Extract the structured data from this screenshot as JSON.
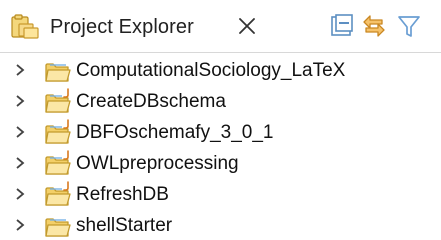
{
  "view": {
    "title": "Project Explorer",
    "toolbar": {
      "collapse_all": "collapse-all-icon",
      "link_with_editor": "link-with-editor-icon",
      "filter": "filter-icon"
    }
  },
  "projects": [
    {
      "name": "ComputationalSociology_LaTeX",
      "java": false
    },
    {
      "name": "CreateDBschema",
      "java": true
    },
    {
      "name": "DBFOschemafy_3_0_1",
      "java": true
    },
    {
      "name": "OWLpreprocessing",
      "java": true
    },
    {
      "name": "RefreshDB",
      "java": true
    },
    {
      "name": "shellStarter",
      "java": false
    }
  ],
  "colors": {
    "folder_fill": "#f3cf68",
    "folder_stroke": "#c29a2c",
    "java_badge": "#d97a1f",
    "icon_blue": "#7ab3e6",
    "toolbar_orange": "#e8a44a"
  }
}
